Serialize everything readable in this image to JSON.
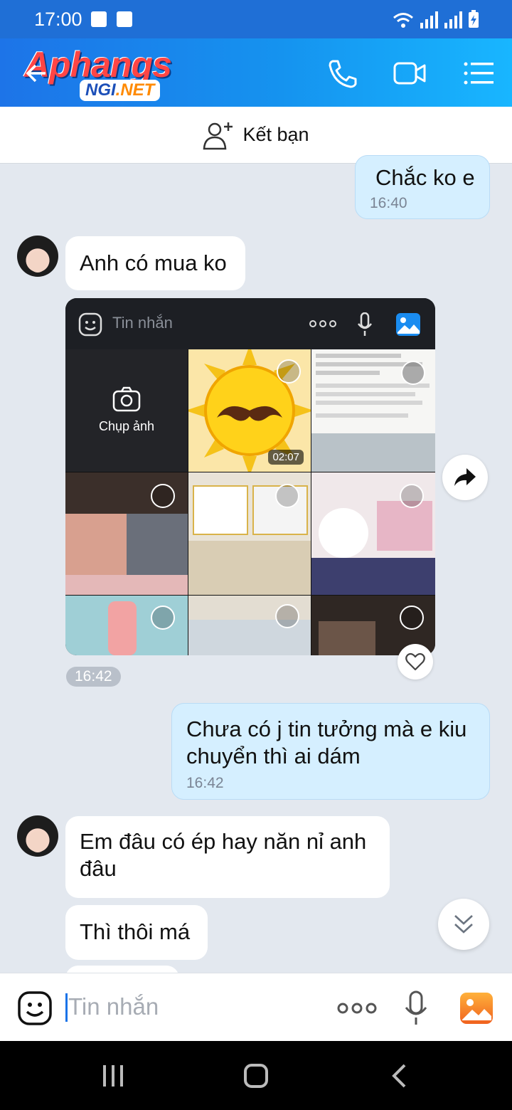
{
  "status_bar": {
    "time": "17:00"
  },
  "header": {
    "logo_text": "Aphangs",
    "logo_badge_left": "NGI",
    "logo_badge_right": ".NET"
  },
  "add_friend": {
    "label": "Kết bạn"
  },
  "messages": {
    "m1": {
      "text": "Chắc ko e",
      "time": "16:40"
    },
    "m2": {
      "text": "Anh có mua ko"
    },
    "m3": {
      "time": "16:42"
    },
    "m4": {
      "line1": "Chưa có j tin tưởng mà e kiu",
      "line2": "chuyển thì ai dám",
      "time": "16:42"
    },
    "m5": {
      "line1": "Em đâu có ép hay năn nỉ anh",
      "line2": "đâu"
    },
    "m6": {
      "text": "Thì thôi má"
    }
  },
  "screenshot_image": {
    "composer_placeholder": "Tin nhắn",
    "camera_label": "Chụp ảnh",
    "video_duration": "02:07"
  },
  "composer": {
    "placeholder": "Tin nhắn"
  },
  "colors": {
    "header": "#1d74e8",
    "outgoing_bubble": "#d5efff",
    "incoming_bubble": "#ffffff",
    "background": "#e3e8ef"
  }
}
